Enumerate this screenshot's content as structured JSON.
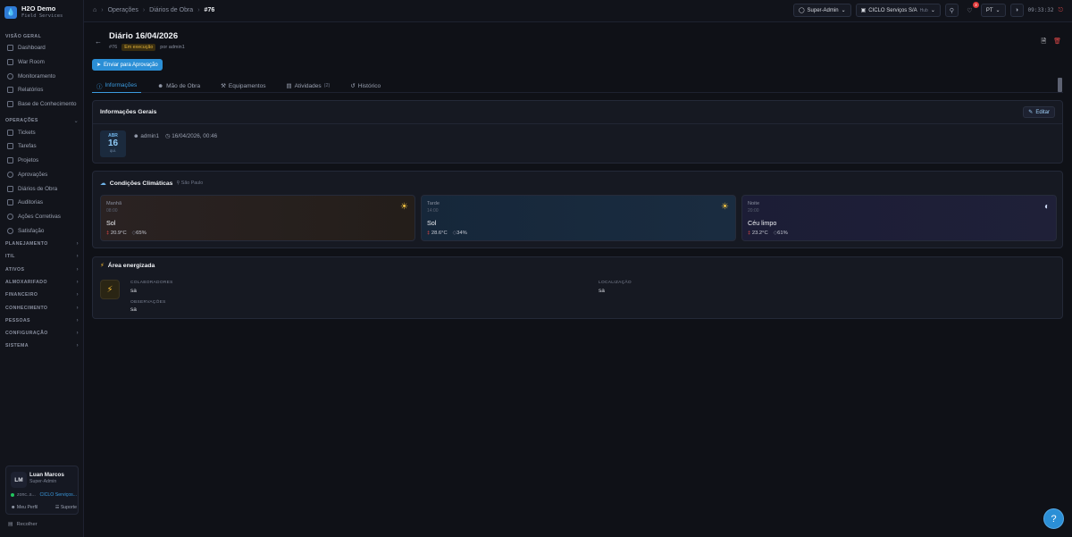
{
  "brand": {
    "name": "H2O Demo",
    "subtitle": "Field Services"
  },
  "sidebar": {
    "section_overview": "VISÃO GERAL",
    "overview_items": [
      {
        "label": "Dashboard",
        "icon": "grid-icon"
      },
      {
        "label": "War Room",
        "icon": "monitor-icon"
      },
      {
        "label": "Monitoramento",
        "icon": "radar-icon"
      },
      {
        "label": "Relatórios",
        "icon": "chart-icon"
      },
      {
        "label": "Base de Conhecimento",
        "icon": "book-icon"
      }
    ],
    "section_operations": "OPERAÇÕES",
    "operations_items": [
      {
        "label": "Tickets",
        "icon": "ticket-icon"
      },
      {
        "label": "Tarefas",
        "icon": "checkbox-icon"
      },
      {
        "label": "Projetos",
        "icon": "folder-icon"
      },
      {
        "label": "Aprovações",
        "icon": "check-circle-icon"
      },
      {
        "label": "Diários de Obra",
        "icon": "journal-icon"
      },
      {
        "label": "Auditorias",
        "icon": "clipboard-icon"
      },
      {
        "label": "Ações Corretivas",
        "icon": "wrench-icon"
      },
      {
        "label": "Satisfação",
        "icon": "smile-icon"
      }
    ],
    "groups": [
      "PLANEJAMENTO",
      "ITIL",
      "ATIVOS",
      "ALMOXARIFADO",
      "FINANCEIRO",
      "CONHECIMENTO",
      "PESSOAS",
      "CONFIGURAÇÃO",
      "SISTEMA"
    ],
    "user": {
      "initials": "LM",
      "name": "Luan Marcos",
      "role": "Super-Admin",
      "status_text": "zonc..s...",
      "company": "CICLO Serviços...",
      "profile_link": "Meu Perfil",
      "support_link": "Suporte"
    },
    "collapse_label": "Recolher"
  },
  "topbar": {
    "breadcrumb": [
      "Operações",
      "Diários de Obra"
    ],
    "breadcrumb_current": "#76",
    "role_selector": "Super-Admin",
    "company_selector": "CICLO Serviços S/A",
    "company_tag": "Hub",
    "notifications_count": "3",
    "language": "PT",
    "clock": "09:33:32"
  },
  "header": {
    "title": "Diário 16/04/2026",
    "id": "#76",
    "status": "Em execução",
    "author": "por admin1",
    "submit_button": "Enviar para Aprovação"
  },
  "tabs": [
    {
      "label": "Informações",
      "icon": "info-icon",
      "active": true
    },
    {
      "label": "Mão de Obra",
      "icon": "users-icon"
    },
    {
      "label": "Equipamentos",
      "icon": "tool-icon"
    },
    {
      "label": "Atividades",
      "icon": "document-icon",
      "count": "(2)"
    },
    {
      "label": "Histórico",
      "icon": "history-icon"
    }
  ],
  "general_info": {
    "title": "Informações Gerais",
    "edit_button": "Editar",
    "date_month": "ABR",
    "date_day": "16",
    "date_weekday": "qui.",
    "user": "admin1",
    "timestamp": "16/04/2026, 00:46"
  },
  "weather": {
    "title": "Condições Climáticas",
    "location": "São Paulo",
    "periods": [
      {
        "period": "Manhã",
        "time": "08:00",
        "condition": "Sol",
        "temperature": "20.9°C",
        "humidity": "65%",
        "icon": "sun-icon"
      },
      {
        "period": "Tarde",
        "time": "14:00",
        "condition": "Sol",
        "temperature": "28.6°C",
        "humidity": "34%",
        "icon": "sun-icon"
      },
      {
        "period": "Noite",
        "time": "20:00",
        "condition": "Céu limpo",
        "temperature": "23.2°C",
        "humidity": "61%",
        "icon": "moon-icon"
      }
    ]
  },
  "energized_area": {
    "title": "Área energizada",
    "collaborators_label": "COLABORADORES",
    "collaborators_value": "sa",
    "location_label": "LOCALIZAÇÃO",
    "location_value": "sa",
    "observations_label": "OBSERVAÇÕES",
    "observations_value": "sa"
  },
  "colors": {
    "accent": "#2b8fd6",
    "status_warning": "#e0b23a",
    "danger": "#e04848",
    "energy": "#f2b832"
  }
}
